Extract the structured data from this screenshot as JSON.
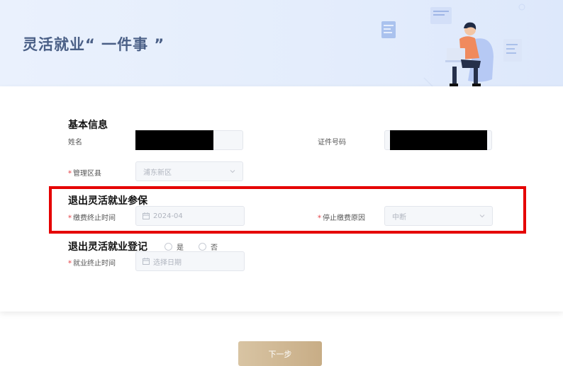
{
  "banner": {
    "title": "灵活就业“ 一件事 ”"
  },
  "basic_info": {
    "title": "基本信息",
    "name_label": "姓名",
    "id_label": "证件号码",
    "district_label": "管理区县",
    "district_value": "浦东新区"
  },
  "exit_insurance": {
    "title": "退出灵活就业参保",
    "end_time_label": "缴费终止时间",
    "end_time_value": "2024-04",
    "stop_reason_label": "停止缴费原因",
    "stop_reason_value": "中断"
  },
  "exit_registration": {
    "title": "退出灵活就业登记",
    "option_yes": "是",
    "option_no": "否",
    "end_time_label": "就业终止时间",
    "end_time_placeholder": "选择日期"
  },
  "actions": {
    "next_label": "下一步"
  },
  "colors": {
    "accent_gold": "#c8ad86",
    "highlight_red": "#e50000",
    "required_star": "#e5484d"
  }
}
